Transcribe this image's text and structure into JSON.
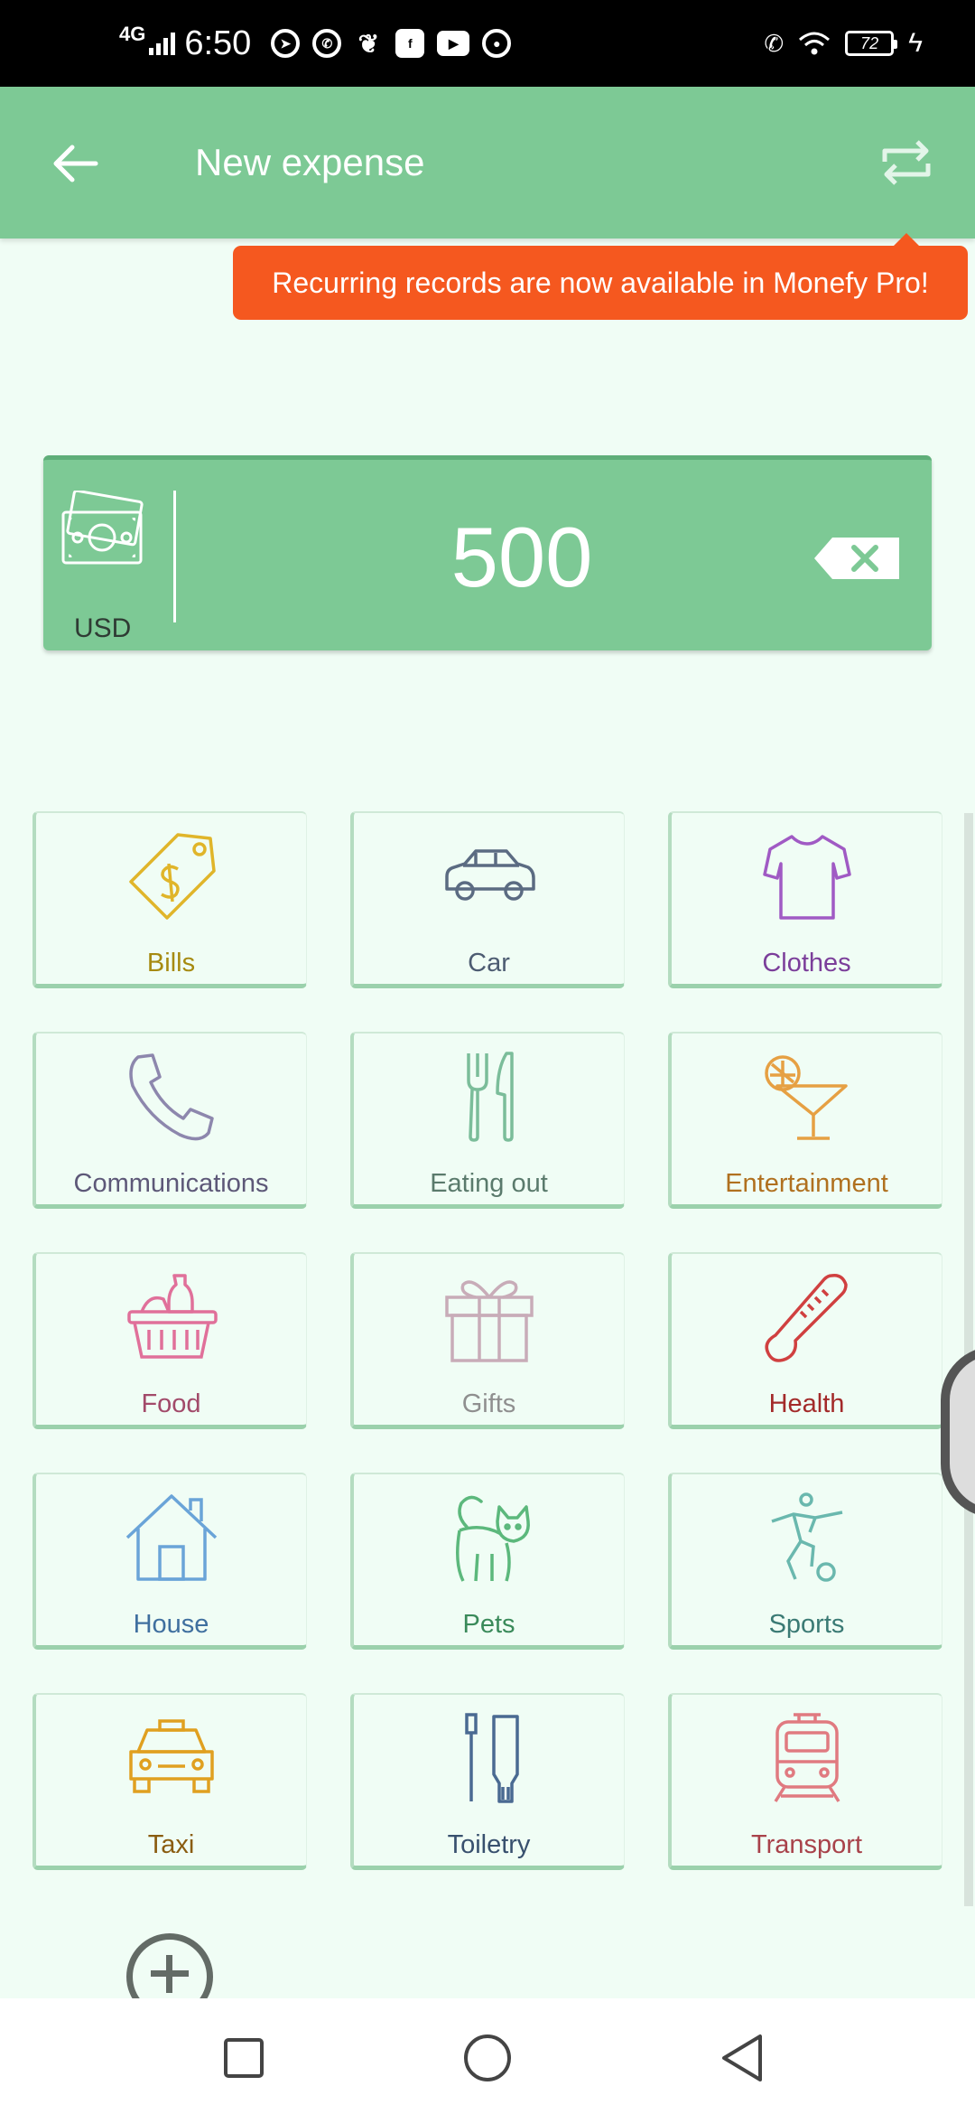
{
  "status_bar": {
    "network": "4G",
    "time": "6:50",
    "battery": "72",
    "apps": [
      "telegram-icon",
      "whatsapp-icon",
      "leaf-icon",
      "facebook-icon",
      "youtube-icon",
      "camera-icon"
    ]
  },
  "app_bar": {
    "title": "New expense",
    "back_icon": "arrow-left-icon",
    "repeat_icon": "repeat-icon"
  },
  "tooltip": {
    "text": "Recurring records are now available in Monefy Pro!"
  },
  "amount": {
    "currency": "USD",
    "value": "500"
  },
  "categories": [
    {
      "label": "Bills",
      "icon": "price-tag-icon",
      "color": "#a68a10"
    },
    {
      "label": "Car",
      "icon": "car-icon",
      "color": "#4d5c72"
    },
    {
      "label": "Clothes",
      "icon": "tshirt-icon",
      "color": "#7b3e9a"
    },
    {
      "label": "Communications",
      "icon": "phone-icon",
      "color": "#5d5878"
    },
    {
      "label": "Eating out",
      "icon": "fork-knife-icon",
      "color": "#5a7a6c"
    },
    {
      "label": "Entertainment",
      "icon": "cocktail-icon",
      "color": "#b0701f"
    },
    {
      "label": "Food",
      "icon": "basket-icon",
      "color": "#a24a6a"
    },
    {
      "label": "Gifts",
      "icon": "gift-icon",
      "color": "#8f8f8f"
    },
    {
      "label": "Health",
      "icon": "thermometer-icon",
      "color": "#a32a2a"
    },
    {
      "label": "House",
      "icon": "house-icon",
      "color": "#3f6f9f"
    },
    {
      "label": "Pets",
      "icon": "cat-icon",
      "color": "#3a8a5a"
    },
    {
      "label": "Sports",
      "icon": "soccer-player-icon",
      "color": "#3a7a74"
    },
    {
      "label": "Taxi",
      "icon": "taxi-icon",
      "color": "#8a5c10"
    },
    {
      "label": "Toiletry",
      "icon": "toothbrush-icon",
      "color": "#38506e"
    },
    {
      "label": "Transport",
      "icon": "train-icon",
      "color": "#a8424a"
    }
  ],
  "colors": {
    "accent": "#7dc995",
    "tooltip": "#f5581f",
    "background": "#f0fdf5"
  }
}
